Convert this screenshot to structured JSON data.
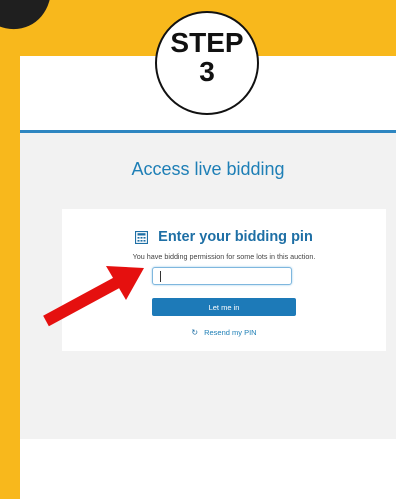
{
  "step": {
    "word": "STEP",
    "number": "3"
  },
  "page": {
    "title": "Access live bidding"
  },
  "card": {
    "heading": "Enter your bidding pin",
    "subtext": "You have bidding permission for some lots in this auction.",
    "pin_value": "",
    "login_button": "Let me in",
    "resend_link": "Resend my PIN"
  },
  "icons": {
    "heading_icon": "calculator-icon",
    "resend_icon": "refresh-icon",
    "pointer": "red-arrow"
  },
  "colors": {
    "background": "#f8b81c",
    "accent": "#1e7fb6",
    "button": "#1d7ab8",
    "arrow": "#e5100f"
  }
}
